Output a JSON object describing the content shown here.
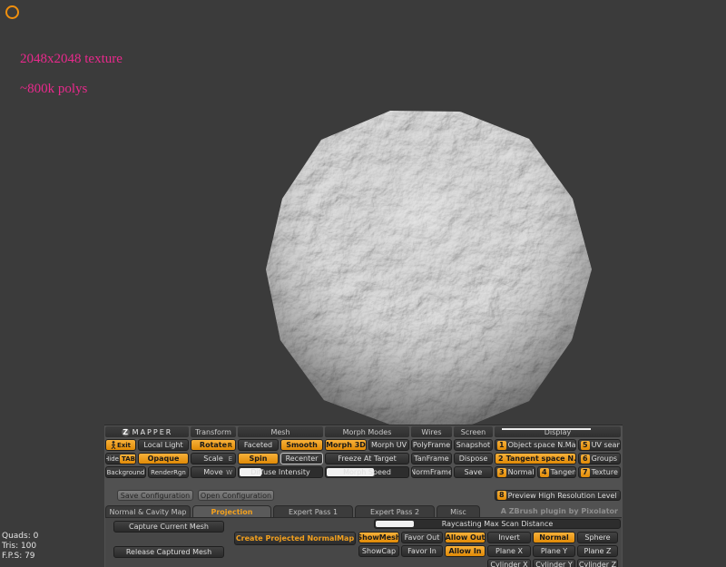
{
  "colors": {
    "accent_orange": "#ef8f0e",
    "annotation_pink": "#e9298c",
    "background": "#3b3b3b"
  },
  "annotations": {
    "texture": "2048x2048 texture",
    "polys": "~800k polys"
  },
  "stats": {
    "quads": "Quads: 0",
    "tris": "Tris: 100",
    "fps": "F.P.S: 79"
  },
  "panel": {
    "logo_z": "Z",
    "logo": "MAPPER",
    "headers": {
      "transform": "Transform",
      "mesh": "Mesh",
      "morph_modes": "Morph Modes",
      "wires": "Wires",
      "screen": "Screen",
      "display": "Display"
    },
    "left": {
      "exit": "Exit",
      "local_light": "Local Light",
      "hide": "Hide",
      "hide_tab": "TAB",
      "opaque": "Opaque",
      "background": "Background",
      "renderrgn": "RenderRgn"
    },
    "transform": {
      "rotate": "Rotate",
      "rotate_key": "R",
      "scale": "Scale",
      "scale_key": "E",
      "move": "Move",
      "move_key": "W"
    },
    "mesh": {
      "faceted": "Faceted",
      "smooth": "Smooth",
      "spin": "Spin",
      "recenter": "Recenter",
      "diffuse_intensity": "Diffuse Intensity"
    },
    "morph": {
      "morph_3d": "Morph 3D",
      "morph_uv": "Morph UV",
      "freeze_at_target": "Freeze At Target",
      "morph_speed": "Morph Speed"
    },
    "wires": {
      "polyframe": "PolyFrame",
      "tanframe": "TanFrame",
      "normframe": "NormFrame"
    },
    "screen": {
      "snapshot": "Snapshot",
      "dispose": "Dispose",
      "save": "Save"
    },
    "display": {
      "obj_space": {
        "num": "1",
        "label": "Object space N.Map"
      },
      "uv_seams": {
        "num": "5",
        "label": "UV seams"
      },
      "tangent_space": {
        "num": "2",
        "label": "Tangent space N.Map"
      },
      "groups": {
        "num": "6",
        "label": "Groups"
      },
      "normals": {
        "num": "3",
        "label": "Normals"
      },
      "tangents": {
        "num": "4",
        "label": "Tangents"
      },
      "texture": {
        "num": "7",
        "label": "Texture"
      },
      "preview": {
        "num": "8",
        "label": "Preview High Resolution Level"
      }
    },
    "config": {
      "save": "Save Configuration",
      "open": "Open Configuration"
    },
    "tabs": [
      "Normal & Cavity Map",
      "Projection",
      "Expert Pass 1",
      "Expert Pass 2",
      "Misc"
    ],
    "credit": "A ZBrush plugin by Pixolator",
    "projection": {
      "capture": "Capture Current Mesh",
      "release": "Release Captured Mesh",
      "create": "Create Projected NormalMap",
      "raycast": "Raycasting Max Scan Distance",
      "showmesh": "ShowMesh",
      "showcap": "ShowCap",
      "favor_out": "Favor Out",
      "favor_in": "Favor In",
      "allow_out": "Allow Out",
      "allow_in": "Allow In",
      "invert": "Invert",
      "normal": "Normal",
      "sphere": "Sphere",
      "plane_x": "Plane X",
      "plane_y": "Plane Y",
      "plane_z": "Plane Z",
      "cylinder_x": "Cylinder X",
      "cylinder_y": "Cylinder Y",
      "cylinder_z": "Cylinder Z"
    }
  }
}
